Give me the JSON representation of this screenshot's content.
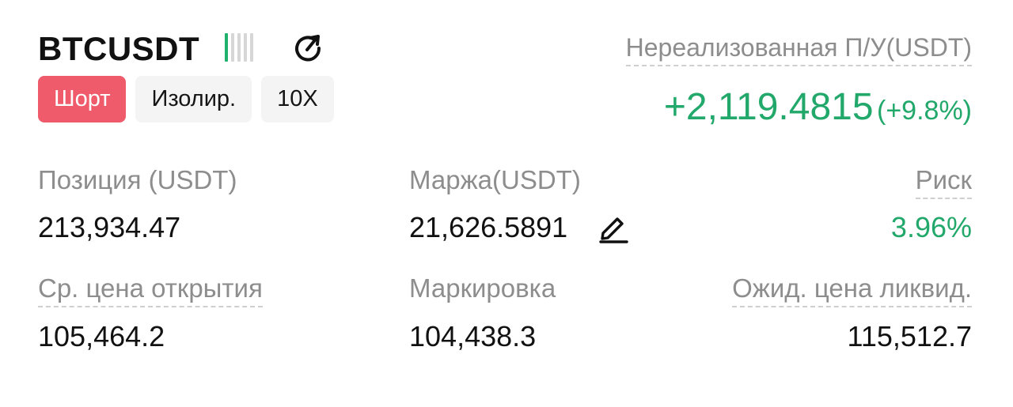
{
  "position": {
    "symbol": "BTCUSDT",
    "side": "Шорт",
    "margin_mode": "Изолир.",
    "leverage": "10X",
    "adl_level": 0.2
  },
  "pnl": {
    "label": "Нереализованная П/У(USDT)",
    "value": "+2,119.4815",
    "percent": "(+9.8%)"
  },
  "metrics": {
    "size_label": "Позиция (USDT)",
    "size_value": "213,934.47",
    "margin_label": "Маржа(USDT)",
    "margin_value": "21,626.5891",
    "risk_label": "Риск",
    "risk_value": "3.96%",
    "entry_label": "Ср. цена открытия",
    "entry_value": "105,464.2",
    "mark_label": "Маркировка",
    "mark_value": "104,438.3",
    "liq_label": "Ожид. цена ликвид.",
    "liq_value": "115,512.7"
  },
  "icons": [
    "adl-bars-icon",
    "share-icon",
    "edit-pencil-icon"
  ],
  "colors": {
    "profit": "#21a86a",
    "short": "#ef5b6a",
    "muted": "#8d8d8d"
  }
}
